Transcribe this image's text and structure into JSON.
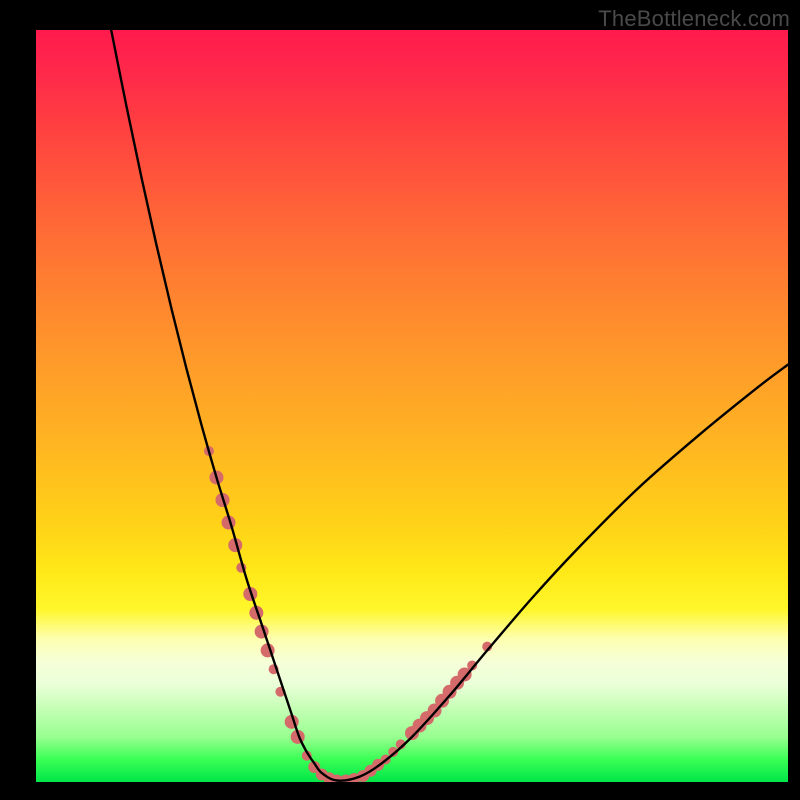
{
  "watermark": "TheBottleneck.com",
  "chart_data": {
    "type": "line",
    "title": "",
    "xlabel": "",
    "ylabel": "",
    "xlim": [
      0,
      100
    ],
    "ylim": [
      0,
      100
    ],
    "series": [
      {
        "name": "curve",
        "color": "#000000",
        "x": [
          10,
          12,
          14,
          16,
          18,
          20,
          22,
          24,
          26,
          28,
          30,
          31,
          32,
          33,
          34,
          35,
          36,
          37,
          38,
          40,
          43,
          46,
          50,
          55,
          60,
          66,
          72,
          80,
          88,
          96,
          100
        ],
        "y": [
          100,
          90,
          80.5,
          71.5,
          63,
          55,
          47.5,
          40.5,
          34,
          27,
          21,
          18,
          15,
          12,
          9,
          6,
          4,
          2.5,
          1.2,
          0.2,
          0.7,
          2.5,
          6,
          11.5,
          17.5,
          24.5,
          31,
          39,
          46,
          52.5,
          55.5
        ]
      },
      {
        "name": "markers",
        "color": "#d46a6a",
        "points": [
          {
            "x": 23.0,
            "y": 44.0,
            "r": 5
          },
          {
            "x": 24.0,
            "y": 40.5,
            "r": 7
          },
          {
            "x": 24.8,
            "y": 37.5,
            "r": 7
          },
          {
            "x": 25.6,
            "y": 34.5,
            "r": 7
          },
          {
            "x": 26.5,
            "y": 31.5,
            "r": 7
          },
          {
            "x": 27.3,
            "y": 28.5,
            "r": 5
          },
          {
            "x": 28.5,
            "y": 25.0,
            "r": 7
          },
          {
            "x": 29.3,
            "y": 22.5,
            "r": 7
          },
          {
            "x": 30.0,
            "y": 20.0,
            "r": 7
          },
          {
            "x": 30.8,
            "y": 17.5,
            "r": 7
          },
          {
            "x": 31.6,
            "y": 15.0,
            "r": 5
          },
          {
            "x": 32.5,
            "y": 12.0,
            "r": 5
          },
          {
            "x": 34.0,
            "y": 8.0,
            "r": 7
          },
          {
            "x": 34.8,
            "y": 6.0,
            "r": 7
          },
          {
            "x": 36.0,
            "y": 3.5,
            "r": 5
          },
          {
            "x": 37.0,
            "y": 2.0,
            "r": 6
          },
          {
            "x": 38.0,
            "y": 1.0,
            "r": 6
          },
          {
            "x": 39.0,
            "y": 0.5,
            "r": 6
          },
          {
            "x": 40.0,
            "y": 0.2,
            "r": 6
          },
          {
            "x": 41.2,
            "y": 0.2,
            "r": 6
          },
          {
            "x": 42.3,
            "y": 0.4,
            "r": 6
          },
          {
            "x": 43.5,
            "y": 0.8,
            "r": 6
          },
          {
            "x": 44.5,
            "y": 1.5,
            "r": 6
          },
          {
            "x": 45.5,
            "y": 2.3,
            "r": 6
          },
          {
            "x": 46.5,
            "y": 3.0,
            "r": 5
          },
          {
            "x": 47.5,
            "y": 4.0,
            "r": 5
          },
          {
            "x": 48.5,
            "y": 5.0,
            "r": 5
          },
          {
            "x": 50.0,
            "y": 6.5,
            "r": 7
          },
          {
            "x": 51.0,
            "y": 7.5,
            "r": 7
          },
          {
            "x": 52.0,
            "y": 8.5,
            "r": 7
          },
          {
            "x": 53.0,
            "y": 9.5,
            "r": 7
          },
          {
            "x": 54.0,
            "y": 10.8,
            "r": 7
          },
          {
            "x": 55.0,
            "y": 12.0,
            "r": 7
          },
          {
            "x": 56.0,
            "y": 13.2,
            "r": 7
          },
          {
            "x": 57.0,
            "y": 14.3,
            "r": 7
          },
          {
            "x": 58.0,
            "y": 15.5,
            "r": 5
          },
          {
            "x": 60.0,
            "y": 18.0,
            "r": 5
          }
        ]
      }
    ]
  }
}
